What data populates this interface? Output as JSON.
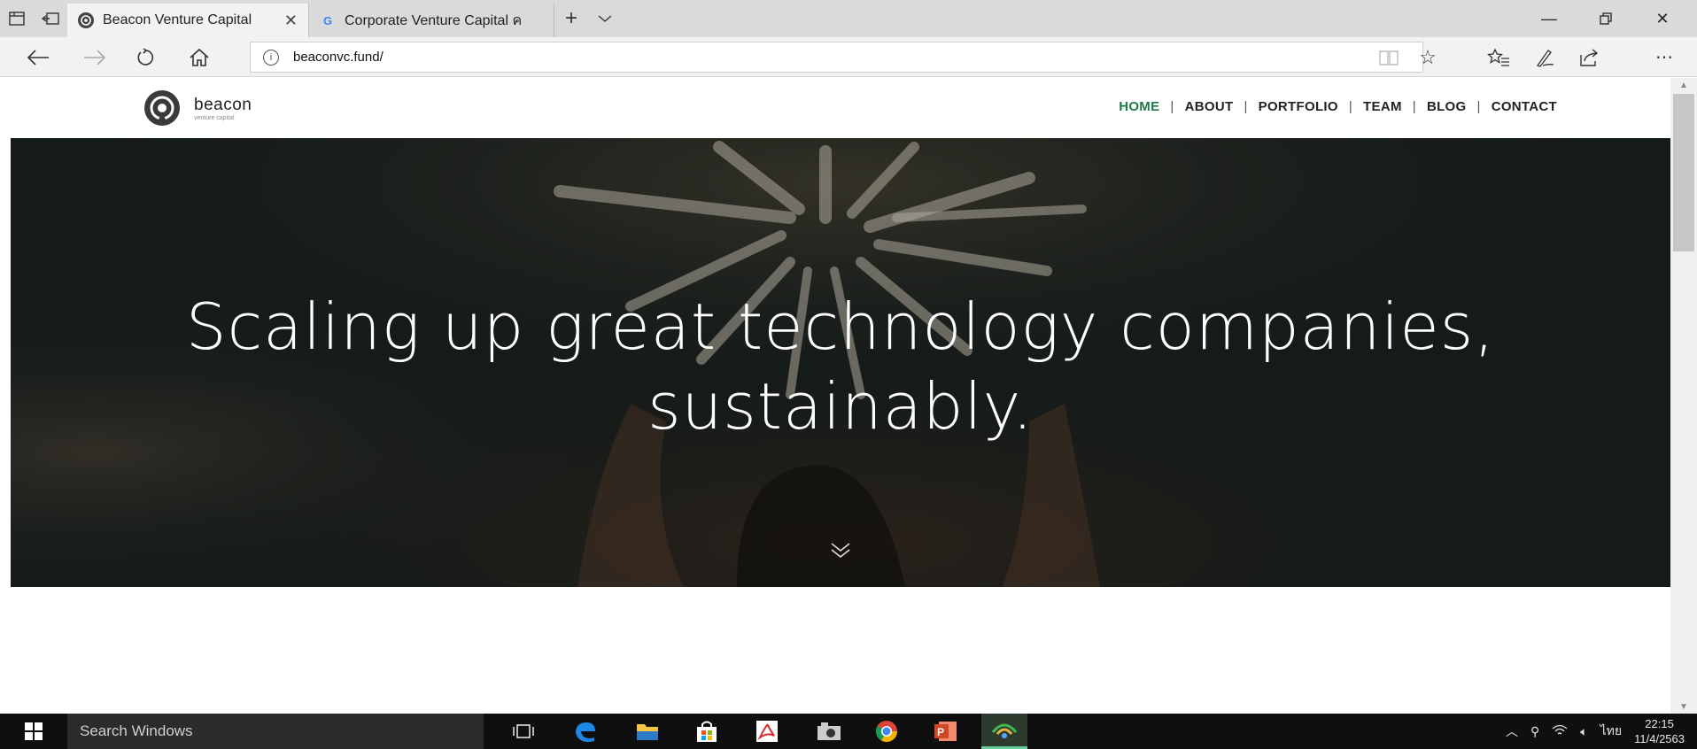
{
  "browser": {
    "tabs": [
      {
        "title": "Beacon Venture Capital",
        "active": true,
        "favicon": "beacon-logo-icon"
      },
      {
        "title": "Corporate Venture Capital ค",
        "active": false,
        "favicon": "google-g-icon"
      }
    ],
    "new_tab_glyph": "+",
    "tab_menu_glyph": "∨",
    "url": "beaconvc.fund/",
    "colors": {
      "tab_strip": "#dadada",
      "toolbar": "#f2f2f2"
    }
  },
  "site": {
    "logo": {
      "name": "beacon",
      "tagline": "venture capital"
    },
    "nav": [
      {
        "label": "HOME",
        "active": true
      },
      {
        "label": "ABOUT",
        "active": false
      },
      {
        "label": "PORTFOLIO",
        "active": false
      },
      {
        "label": "TEAM",
        "active": false
      },
      {
        "label": "BLOG",
        "active": false
      },
      {
        "label": "CONTACT",
        "active": false
      }
    ],
    "nav_separator": "|",
    "hero": {
      "line1": "Scaling up great technology companies,",
      "line2": "sustainably."
    },
    "colors": {
      "nav_active": "#1f7a4a",
      "hero_overlay": "#1b2320"
    }
  },
  "taskbar": {
    "search_placeholder": "Search Windows",
    "pinned": [
      "task-view-icon",
      "edge-icon",
      "file-explorer-icon",
      "store-icon",
      "acrobat-icon",
      "camera-app-icon",
      "chrome-icon",
      "powerpoint-icon",
      "network-app-icon"
    ],
    "language": "ไทย",
    "time": "22:15",
    "date": "11/4/2563"
  }
}
